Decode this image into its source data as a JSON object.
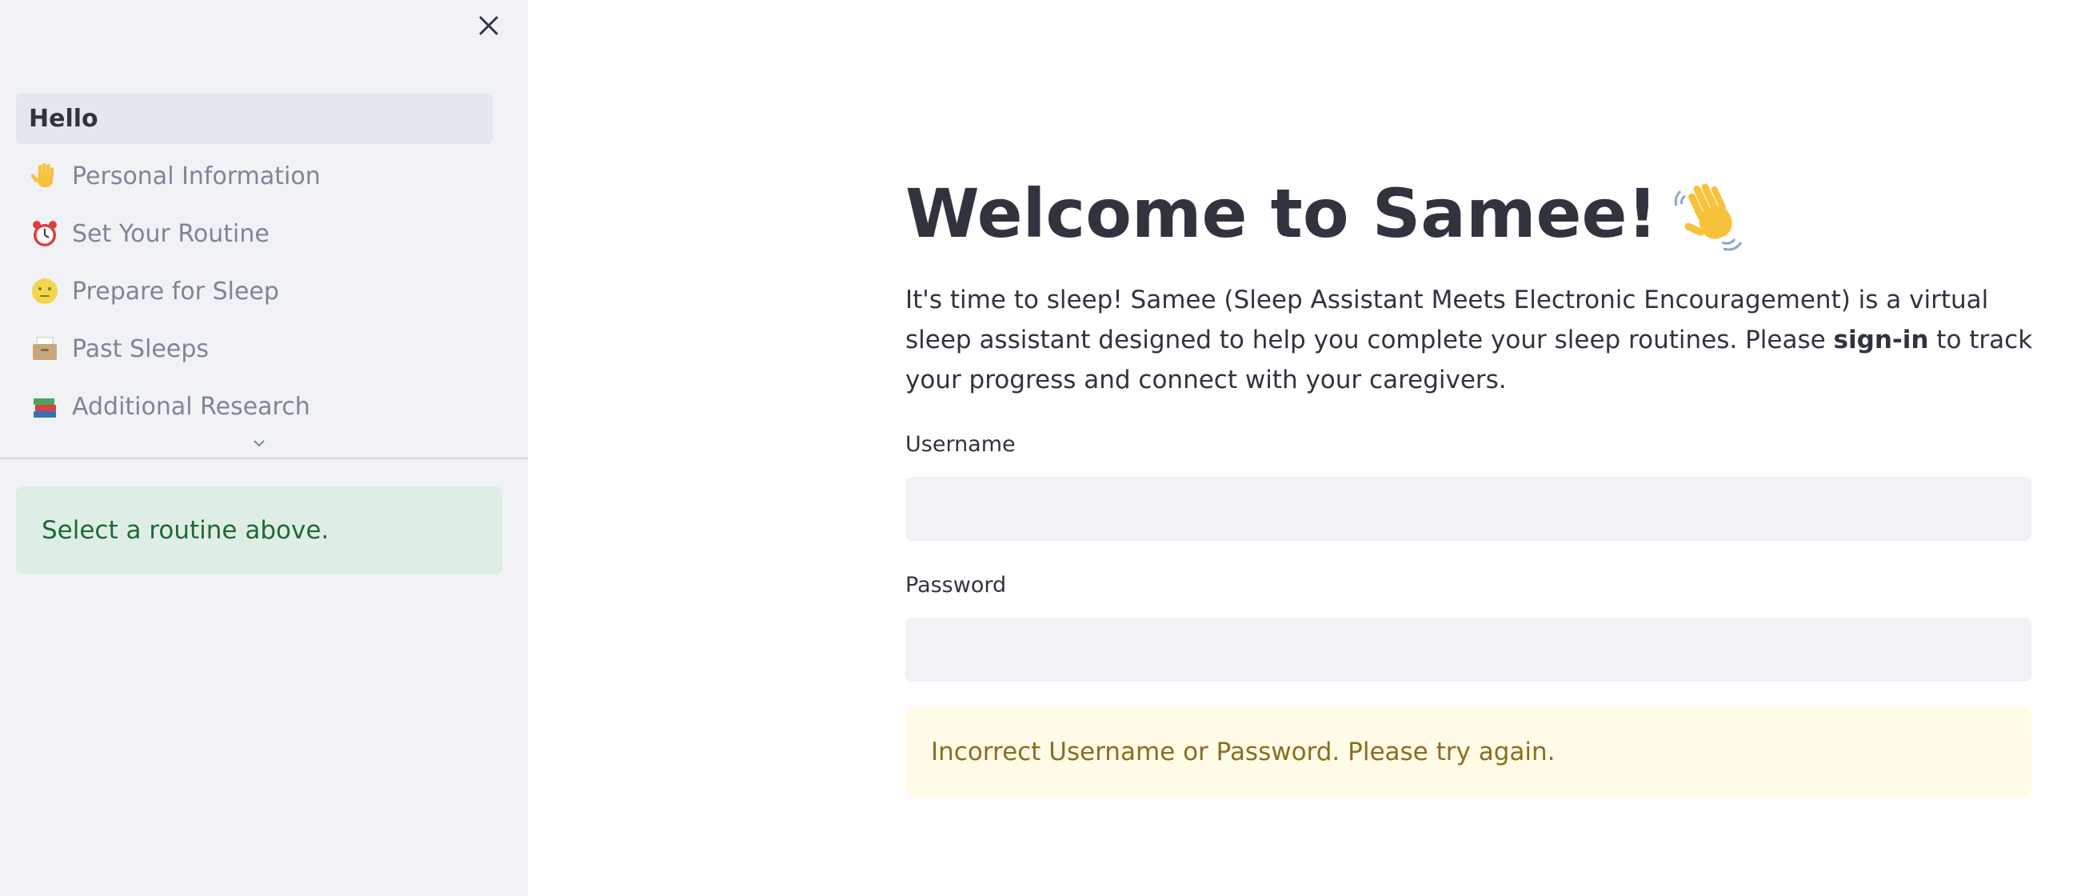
{
  "sidebar": {
    "close_icon": "close-icon",
    "nav_items": [
      {
        "label": "Hello",
        "icon": "",
        "active": true
      },
      {
        "label": "Personal Information",
        "icon": "raised-hand-icon",
        "active": false
      },
      {
        "label": "Set Your Routine",
        "icon": "alarm-clock-icon",
        "active": false
      },
      {
        "label": "Prepare for Sleep",
        "icon": "moon-face-icon",
        "active": false
      },
      {
        "label": "Past Sleeps",
        "icon": "card-file-box-icon",
        "active": false
      },
      {
        "label": "Additional Research",
        "icon": "books-icon",
        "active": false
      }
    ],
    "expand_icon": "chevron-down-icon",
    "info_message": "Select a routine above."
  },
  "main": {
    "title": "Welcome to Samee!",
    "title_icon": "waving-hand-icon",
    "intro_before": "It's time to sleep! Samee (Sleep Assistant Meets Electronic Encouragement) is a virtual sleep assistant designed to help you complete your sleep routines. Please ",
    "intro_bold": "sign-in",
    "intro_after": " to track your progress and connect with your caregivers.",
    "username_label": "Username",
    "username_value": "",
    "password_label": "Password",
    "password_value": "",
    "warning_message": "Incorrect Username or Password. Please try again."
  },
  "colors": {
    "sidebar_bg": "#f0f2f6",
    "active_nav_bg": "#e3e7ee",
    "success_bg": "#dfeee5",
    "success_text": "#1e6a34",
    "warning_bg": "#fffbe6",
    "warning_text": "#8a6d1f",
    "text": "#31333f"
  }
}
